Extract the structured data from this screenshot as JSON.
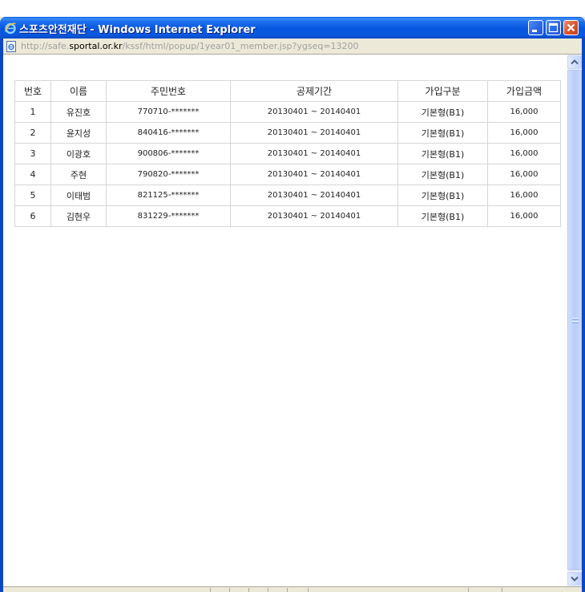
{
  "window": {
    "title": "스포츠안전재단 - Windows Internet Explorer"
  },
  "address": {
    "prefix": "http://safe.",
    "domain": "sportal.or.kr",
    "path": "/kssf/html/popup/1year01_member.jsp?ygseq=13200"
  },
  "table": {
    "headers": [
      "번호",
      "이름",
      "주민번호",
      "공제기간",
      "가입구분",
      "가입금액"
    ],
    "rows": [
      [
        "1",
        "유진호",
        "770710-*******",
        "20130401 ~ 20140401",
        "기본형(B1)",
        "16,000"
      ],
      [
        "2",
        "윤지성",
        "840416-*******",
        "20130401 ~ 20140401",
        "기본형(B1)",
        "16,000"
      ],
      [
        "3",
        "이광호",
        "900806-*******",
        "20130401 ~ 20140401",
        "기본형(B1)",
        "16,000"
      ],
      [
        "4",
        "주현",
        "790820-*******",
        "20130401 ~ 20140401",
        "기본형(B1)",
        "16,000"
      ],
      [
        "5",
        "이태범",
        "821125-*******",
        "20130401 ~ 20140401",
        "기본형(B1)",
        "16,000"
      ],
      [
        "6",
        "김현우",
        "831229-*******",
        "20130401 ~ 20140401",
        "기본형(B1)",
        "16,000"
      ]
    ]
  },
  "colors": {
    "titlebar": "#0A58DE",
    "close_button": "#D8532B",
    "grid_line": "#D6D6D6"
  },
  "icons": {
    "title": "internet-explorer-icon",
    "address": "page-icon",
    "scroll_up": "arrow-up-icon",
    "scroll_down": "arrow-down-icon"
  }
}
